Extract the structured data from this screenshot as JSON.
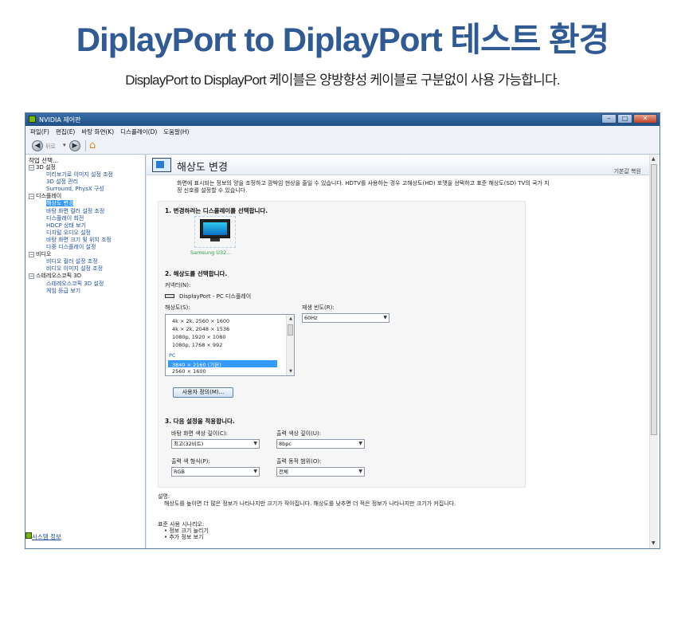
{
  "banner": {
    "title": "DiplayPort to DiplayPort 테스트 환경",
    "subtitle": "DisplayPort to DisplayPort 케이블은 양방향성 케이블로 구분없이 사용 가능합니다."
  },
  "window": {
    "title": "NVIDIA 제어판",
    "buttons": {
      "minimize": "–",
      "maximize": "□",
      "close": "✕"
    }
  },
  "menu": [
    "파일(F)",
    "편집(E)",
    "바탕 화면(K)",
    "디스플레이(D)",
    "도움말(H)"
  ],
  "toolbar": {
    "back_label": "뒤로",
    "back_glyph": "◀",
    "forward_glyph": "▶",
    "dropdown_glyph": "▾",
    "home_glyph": "⌂"
  },
  "sidebar": {
    "heading": "작업 선택...",
    "tree": [
      {
        "label": "3D 설정",
        "kind": "cat",
        "exp": "−"
      },
      {
        "label": "미리보기로 이미지 설정 조정",
        "kind": "link"
      },
      {
        "label": "3D 설정 관리",
        "kind": "link"
      },
      {
        "label": "Surround, PhysX 구성",
        "kind": "link"
      },
      {
        "label": "디스플레이",
        "kind": "cat",
        "exp": "−"
      },
      {
        "label": "해상도 변경",
        "kind": "link",
        "selected": true
      },
      {
        "label": "바탕 화면 컬러 설정 조정",
        "kind": "link"
      },
      {
        "label": "디스플레이 회전",
        "kind": "link"
      },
      {
        "label": "HDCP 상태 보기",
        "kind": "link"
      },
      {
        "label": "디지털 오디오 설정",
        "kind": "link"
      },
      {
        "label": "바탕 화면 크기 및 위치 조정",
        "kind": "link"
      },
      {
        "label": "다중 디스플레이 설정",
        "kind": "link"
      },
      {
        "label": "비디오",
        "kind": "cat",
        "exp": "−"
      },
      {
        "label": "비디오 컬러 설정 조정",
        "kind": "link"
      },
      {
        "label": "비디오 이미지 설정 조정",
        "kind": "link"
      },
      {
        "label": "스테레오스코픽 3D",
        "kind": "cat",
        "exp": "−"
      },
      {
        "label": "스테레오스코픽 3D 설정",
        "kind": "link"
      },
      {
        "label": "게임 등급 보기",
        "kind": "link"
      }
    ],
    "system_info": "시스템 정보"
  },
  "content": {
    "title": "해상도 변경",
    "restore": "기본값 복원",
    "description_1": "화면에 표시되는 정보의 양을 조정하고 깜박임 현상을 줄일 수 있습니다. HDTV를 사용하는 경우 고해상도(HD) 포맷을 선택하고 표준 해상도(SD) TV의 국가 지",
    "description_2": "정 신호를 설정할 수 있습니다.",
    "step1": "1. 변경하려는 디스플레이를 선택합니다.",
    "monitor_label": "Samsung U32...",
    "step2": "2. 해상도를 선택합니다.",
    "connector_label": "커넥터(N):",
    "connector_value": "DisplayPort - PC 디스플레이",
    "resolution_label": "해상도(S):",
    "resolutions_ultra": [
      "4k × 2k, 2560 × 1600",
      "4k × 2k, 2048 × 1536",
      "1080p, 1920 × 1080",
      "1080p, 1768 × 992"
    ],
    "pc_group": "PC",
    "resolution_selected": "3840 × 2160 (기본)",
    "resolution_next": "2560 × 1600",
    "refresh_label": "재생 빈도(R):",
    "refresh_value": "60Hz",
    "custom_button": "사용자 정의(M)...",
    "step3": "3. 다음 설정을 적용합니다.",
    "desktop_color_label": "바탕 화면 색상 깊이(C):",
    "desktop_color_value": "최고(32비트)",
    "output_depth_label": "출력 색상 깊이(U):",
    "output_depth_value": "8bpc",
    "output_format_label": "출력 색 형식(P):",
    "output_format_value": "RGB",
    "output_range_label": "출력 동적 범위(O):",
    "output_range_value": "전체",
    "explain_head": "설명:",
    "explain_body": "해상도를 높이면 더 많은 정보가 나타나지만 크기가 작아집니다. 해상도를 낮추면 더 적은 정보가 나타나지만 크기가 커집니다.",
    "scenario_head": "표준 사용 시나리오:",
    "scenario_1": "• 정보 크기 늘리기",
    "scenario_2": "• 추가 정보 보기"
  },
  "colors": {
    "banner_title": "#2f5a94",
    "accent_selection": "#3399ff",
    "nvidia_green": "#76b900"
  }
}
